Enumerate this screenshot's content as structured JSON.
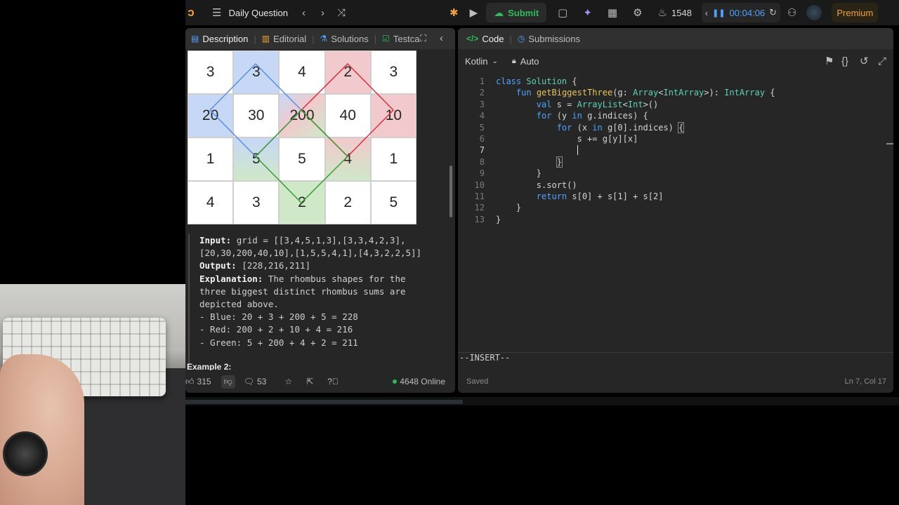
{
  "topbar": {
    "title": "Daily Question",
    "submit_label": "Submit",
    "streak": "1548",
    "timer": "00:04:06",
    "premium_label": "Premium"
  },
  "left": {
    "tabs": [
      "Description",
      "Editorial",
      "Solutions",
      "Testca"
    ],
    "grid": [
      [
        "3",
        "3",
        "4",
        "2",
        "3"
      ],
      [
        "20",
        "30",
        "200",
        "40",
        "10"
      ],
      [
        "1",
        "5",
        "5",
        "4",
        "1"
      ],
      [
        "4",
        "3",
        "2",
        "2",
        "5"
      ]
    ],
    "example": {
      "input_label": "Input:",
      "input_value_1": "grid = [[3,4,5,1,3],[3,3,4,2,3],",
      "input_value_2": "[20,30,200,40,10],[1,5,5,4,1],[4,3,2,2,5]]",
      "output_label": "Output:",
      "output_value": "[228,216,211]",
      "explanation_label": "Explanation:",
      "explanation_1": "The rhombus shapes for the",
      "explanation_2": "three biggest distinct rhombus sums are",
      "explanation_3": "depicted above.",
      "bullets": [
        "- Blue: 20 + 3 + 200 + 5 = 228",
        "- Red: 200 + 2 + 10 + 4 = 216",
        "- Green: 5 + 200 + 4 + 2 = 211"
      ]
    },
    "example2_title": "Example 2:",
    "likes": "315",
    "comments": "53",
    "online": "4648 Online"
  },
  "right": {
    "tab_code": "Code",
    "tab_submissions": "Submissions",
    "language": "Kotlin",
    "mode": "Auto",
    "line_numbers": [
      "1",
      "2",
      "3",
      "4",
      "5",
      "6",
      "7",
      "8",
      "9",
      "10",
      "11",
      "12",
      "13"
    ],
    "status_mode": "--INSERT--",
    "saved": "Saved",
    "cursor_pos": "Ln 7, Col 17"
  },
  "colors": {
    "accent_green": "#2cbb5d",
    "accent_blue": "#4fa2ff",
    "premium": "#f0a23b"
  }
}
